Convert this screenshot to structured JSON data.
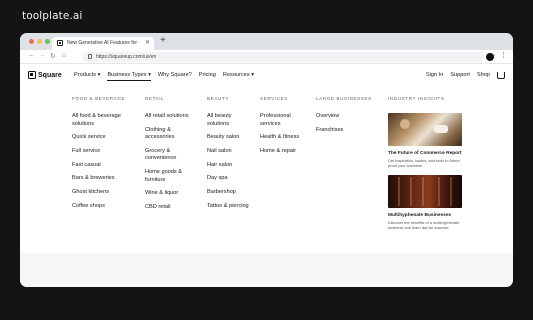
{
  "brand": "toolplate.ai",
  "browser": {
    "tab_title": "New Generative AI Features for",
    "url": "https://squareup.com/us/en"
  },
  "site": {
    "logo_text": "Square",
    "nav": [
      "Products",
      "Business Types",
      "Why Square?",
      "Pricing",
      "Resources"
    ],
    "right": [
      "Sign In",
      "Support",
      "Shop"
    ]
  },
  "menu": {
    "columns": [
      {
        "heading": "FOOD & BEVERAGE",
        "links": [
          "All food & beverage solutions",
          "Quick service",
          "Full service",
          "Fast casual",
          "Bars & breweries",
          "Ghost kitchens",
          "Coffee shops"
        ]
      },
      {
        "heading": "RETAIL",
        "links": [
          "All retail solutions",
          "Clothing & accessories",
          "Grocery & convenience",
          "Home goods & furniture",
          "Wine & liquor",
          "CBD retail"
        ]
      },
      {
        "heading": "BEAUTY",
        "links": [
          "All beauty solutions",
          "Beauty salon",
          "Nail salon",
          "Hair salon",
          "Day spa",
          "Barbershop",
          "Tattoo & piercing"
        ]
      },
      {
        "heading": "SERVICES",
        "links": [
          "Professional services",
          "Health & fitness",
          "Home & repair"
        ]
      },
      {
        "heading": "LARGE BUSINESSES",
        "links": [
          "Overview",
          "Franchises"
        ]
      }
    ],
    "insights": {
      "heading": "INDUSTRY INSIGHTS",
      "cards": [
        {
          "title": "The Future of Commerce Report",
          "desc": "Get inspiration, tactics, and tools to future-proof your business."
        },
        {
          "title": "Multihyphenate Businesses",
          "desc": "Discover the benefits of a multihyphenate business and learn tips for success."
        }
      ]
    }
  }
}
